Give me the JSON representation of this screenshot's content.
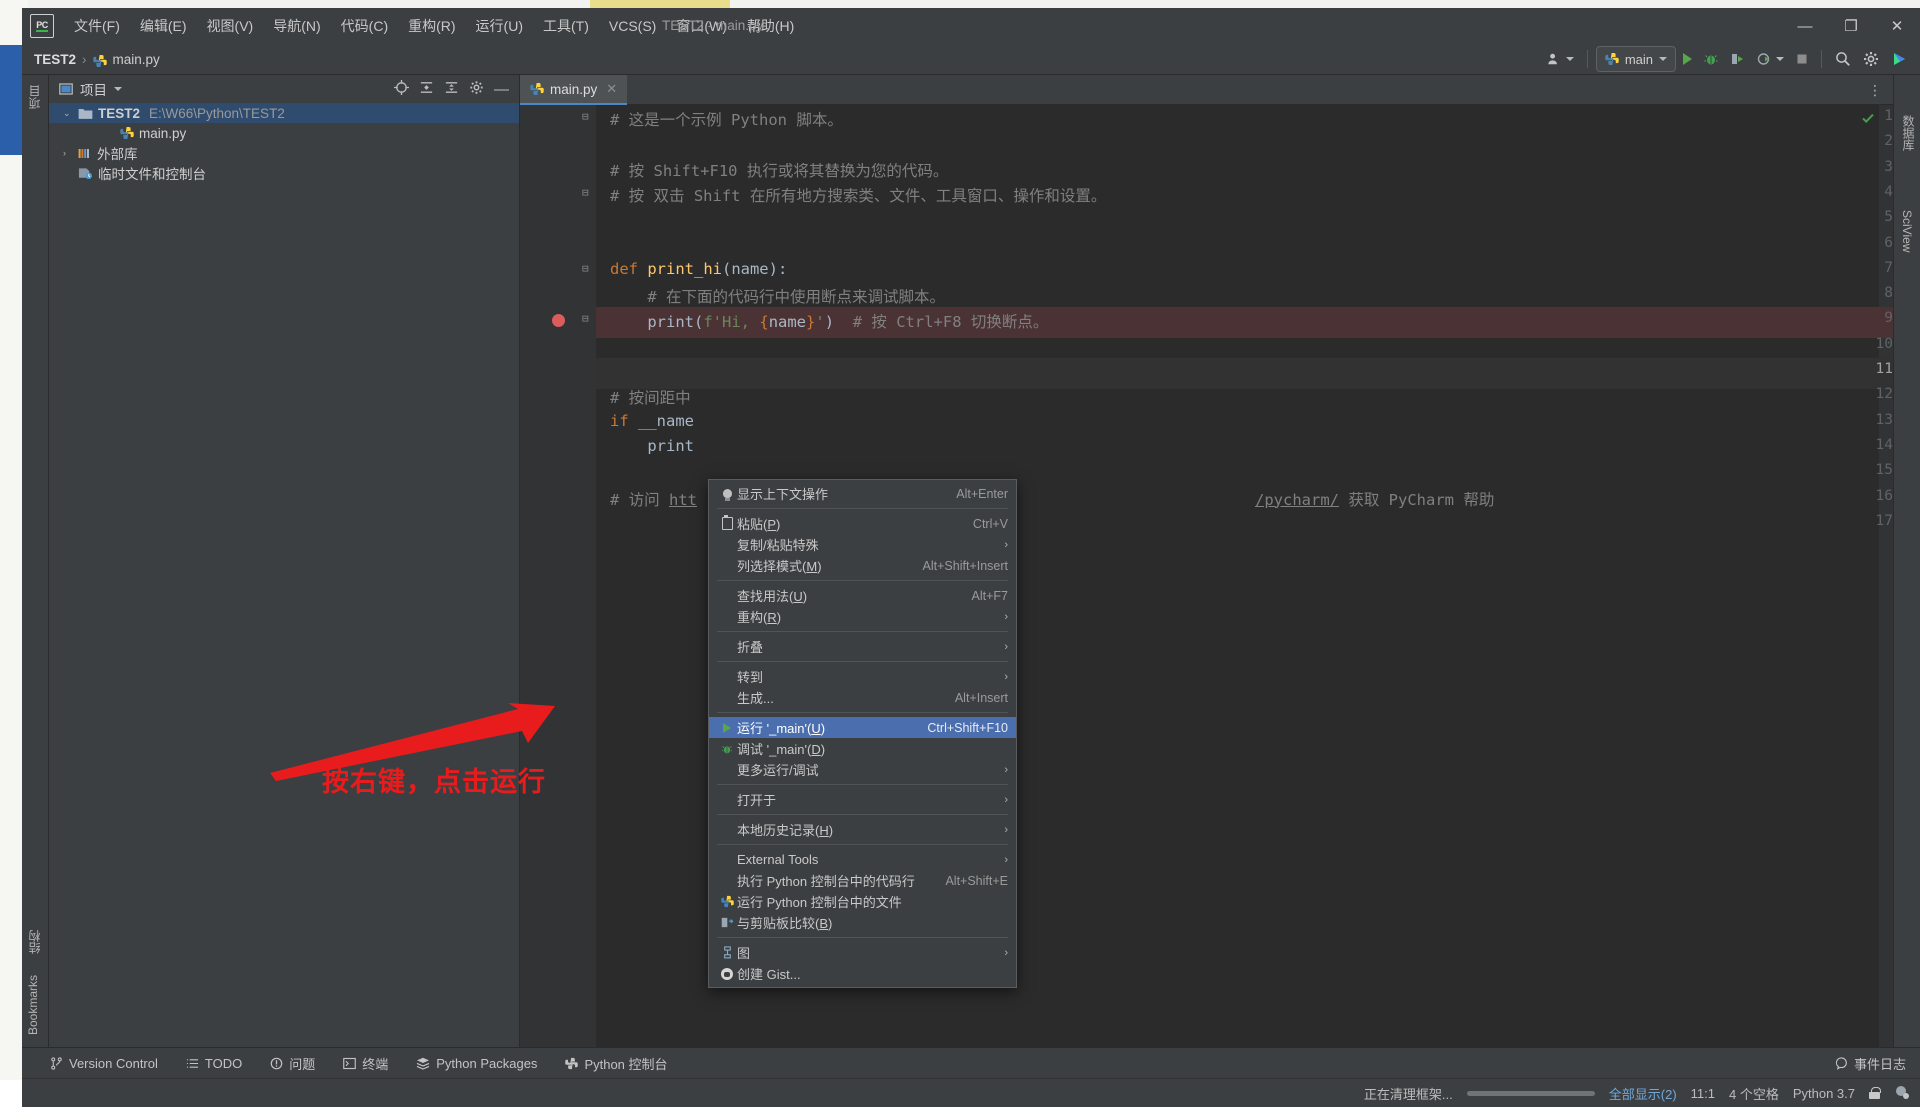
{
  "window": {
    "title": "TEST2 - main.py",
    "minimize": "—",
    "maximize": "❐",
    "close": "✕"
  },
  "menubar": {
    "items": [
      {
        "label": "文件(F)",
        "name": "menu-file"
      },
      {
        "label": "编辑(E)",
        "name": "menu-edit"
      },
      {
        "label": "视图(V)",
        "name": "menu-view"
      },
      {
        "label": "导航(N)",
        "name": "menu-navigate"
      },
      {
        "label": "代码(C)",
        "name": "menu-code"
      },
      {
        "label": "重构(R)",
        "name": "menu-refactor"
      },
      {
        "label": "运行(U)",
        "name": "menu-run"
      },
      {
        "label": "工具(T)",
        "name": "menu-tools"
      },
      {
        "label": "VCS(S)",
        "name": "menu-vcs"
      },
      {
        "label": "窗口(W)",
        "name": "menu-window"
      },
      {
        "label": "帮助(H)",
        "name": "menu-help"
      }
    ]
  },
  "breadcrumb": {
    "project": "TEST2",
    "separator": "›",
    "file": "main.py"
  },
  "toolbar": {
    "run_config": "main",
    "run_tooltip": "运行",
    "debug_tooltip": "调试",
    "coverage_tooltip": "运行覆盖率",
    "profile_tooltip": "分析",
    "stop_tooltip": "停止",
    "search_tooltip": "搜索",
    "settings_tooltip": "设置"
  },
  "left_strip": {
    "project_label": "项目",
    "structure_label": "结构",
    "bookmarks_label": "Bookmarks"
  },
  "right_strip": {
    "database_label": "数据库",
    "sciview_label": "SciView"
  },
  "project_panel": {
    "title": "项目",
    "tree": [
      {
        "label": "TEST2",
        "path": "E:\\W66\\Python\\TEST2",
        "icon": "folder-icon",
        "selected": true,
        "arrow": "⌄",
        "depth": 0
      },
      {
        "label": "main.py",
        "path": "",
        "icon": "python-file-icon",
        "selected": false,
        "arrow": "",
        "depth": 1
      },
      {
        "label": "外部库",
        "path": "",
        "icon": "library-icon",
        "selected": false,
        "arrow": "›",
        "depth": 0
      },
      {
        "label": "临时文件和控制台",
        "path": "",
        "icon": "scratches-icon",
        "selected": false,
        "arrow": "",
        "depth": 0
      }
    ]
  },
  "editor": {
    "tab": {
      "label": "main.py",
      "close": "✕"
    },
    "cursor_line_number": 11,
    "breakpoint_line": 9,
    "lines": [
      {
        "n": 1,
        "fold": "⊟",
        "tokens": [
          {
            "t": "# 这是一个示例 Python 脚本。",
            "c": "cm"
          }
        ],
        "indent": 0
      },
      {
        "n": 2,
        "fold": "",
        "tokens": [],
        "indent": 0
      },
      {
        "n": 3,
        "fold": "",
        "tokens": [
          {
            "t": "# 按 Shift+F10 执行或将其替换为您的代码。",
            "c": "cm"
          }
        ],
        "indent": 0
      },
      {
        "n": 4,
        "fold": "⊟",
        "tokens": [
          {
            "t": "# 按 双击 Shift 在所有地方搜索类、文件、工具窗口、操作和设置。",
            "c": "cm"
          }
        ],
        "indent": 0
      },
      {
        "n": 5,
        "fold": "",
        "tokens": [],
        "indent": 0
      },
      {
        "n": 6,
        "fold": "",
        "tokens": [],
        "indent": 0
      },
      {
        "n": 7,
        "fold": "⊟",
        "tokens": [
          {
            "t": "def ",
            "c": "kw"
          },
          {
            "t": "print_hi",
            "c": "fn"
          },
          {
            "t": "(name):",
            "c": "pm"
          }
        ],
        "indent": 0
      },
      {
        "n": 8,
        "fold": "",
        "tokens": [
          {
            "t": "    # 在下面的代码行中使用断点来调试脚本。",
            "c": "cm"
          }
        ],
        "indent": 1
      },
      {
        "n": 9,
        "fold": "⊟",
        "tokens": [
          {
            "t": "    print",
            "c": "pm"
          },
          {
            "t": "(",
            "c": "br"
          },
          {
            "t": "f'Hi, ",
            "c": "st"
          },
          {
            "t": "{",
            "c": "kw"
          },
          {
            "t": "name",
            "c": "pm"
          },
          {
            "t": "}",
            "c": "kw"
          },
          {
            "t": "'",
            "c": "st"
          },
          {
            "t": ")",
            "c": "br"
          },
          {
            "t": "  # 按 Ctrl+F8 切换断点。",
            "c": "cm"
          }
        ],
        "indent": 1
      },
      {
        "n": 10,
        "fold": "",
        "tokens": [],
        "indent": 0
      },
      {
        "n": 11,
        "fold": "",
        "tokens": [],
        "indent": 0
      },
      {
        "n": 12,
        "fold": "",
        "tokens": [
          {
            "t": "# 按间距中",
            "c": "cm"
          }
        ],
        "indent": 0
      },
      {
        "n": 13,
        "fold": "",
        "tokens": [
          {
            "t": "if ",
            "c": "kw"
          },
          {
            "t": "__name",
            "c": "pm"
          }
        ],
        "indent": 0
      },
      {
        "n": 14,
        "fold": "",
        "tokens": [
          {
            "t": "    print",
            "c": "pm"
          }
        ],
        "indent": 1
      },
      {
        "n": 15,
        "fold": "",
        "tokens": [],
        "indent": 0
      },
      {
        "n": 16,
        "fold": "",
        "tokens": [
          {
            "t": "# 访问 ",
            "c": "cm"
          },
          {
            "t": "htt",
            "c": "link"
          }
        ],
        "indent": 0
      },
      {
        "n": 17,
        "fold": "",
        "tokens": [],
        "indent": 0
      }
    ],
    "line16_tail": "/pycharm/ 获取 PyCharm 帮助"
  },
  "context_menu": {
    "groups": [
      [
        {
          "label": "显示上下文操作",
          "accel": "Alt+Enter",
          "icon": "bulb-icon",
          "submenu": false,
          "selected": false,
          "name": "menu-show-context-actions"
        }
      ],
      [
        {
          "label": "粘贴(P)",
          "accel": "Ctrl+V",
          "icon": "clipboard-icon",
          "submenu": false,
          "selected": false,
          "name": "menu-paste"
        },
        {
          "label": "复制/粘贴特殊",
          "accel": "",
          "icon": "",
          "submenu": true,
          "selected": false,
          "name": "menu-copy-paste-special"
        },
        {
          "label": "列选择模式(M)",
          "accel": "Alt+Shift+Insert",
          "icon": "",
          "submenu": false,
          "selected": false,
          "name": "menu-column-selection-mode"
        }
      ],
      [
        {
          "label": "查找用法(U)",
          "accel": "Alt+F7",
          "icon": "",
          "submenu": false,
          "selected": false,
          "name": "menu-find-usages"
        },
        {
          "label": "重构(R)",
          "accel": "",
          "icon": "",
          "submenu": true,
          "selected": false,
          "name": "menu-refactor"
        }
      ],
      [
        {
          "label": "折叠",
          "accel": "",
          "icon": "",
          "submenu": true,
          "selected": false,
          "name": "menu-folding"
        }
      ],
      [
        {
          "label": "转到",
          "accel": "",
          "icon": "",
          "submenu": true,
          "selected": false,
          "name": "menu-goto"
        },
        {
          "label": "生成...",
          "accel": "Alt+Insert",
          "icon": "",
          "submenu": false,
          "selected": false,
          "name": "menu-generate"
        }
      ],
      [
        {
          "label": "运行 '_main'(U)",
          "accel": "Ctrl+Shift+F10",
          "icon": "run-icon",
          "submenu": false,
          "selected": true,
          "name": "menu-run-main"
        },
        {
          "label": "调试 '_main'(D)",
          "accel": "",
          "icon": "debug-icon",
          "submenu": false,
          "selected": false,
          "name": "menu-debug-main"
        },
        {
          "label": "更多运行/调试",
          "accel": "",
          "icon": "",
          "submenu": true,
          "selected": false,
          "name": "menu-more-run-debug"
        }
      ],
      [
        {
          "label": "打开于",
          "accel": "",
          "icon": "",
          "submenu": true,
          "selected": false,
          "name": "menu-open-in"
        }
      ],
      [
        {
          "label": "本地历史记录(H)",
          "accel": "",
          "icon": "",
          "submenu": true,
          "selected": false,
          "name": "menu-local-history"
        }
      ],
      [
        {
          "label": "External Tools",
          "accel": "",
          "icon": "",
          "submenu": true,
          "selected": false,
          "name": "menu-external-tools"
        },
        {
          "label": "执行 Python 控制台中的代码行",
          "accel": "Alt+Shift+E",
          "icon": "",
          "submenu": false,
          "selected": false,
          "name": "menu-execute-line-in-console"
        },
        {
          "label": "运行 Python 控制台中的文件",
          "accel": "",
          "icon": "python-icon",
          "submenu": false,
          "selected": false,
          "name": "menu-run-file-in-console"
        },
        {
          "label": "与剪贴板比较(B)",
          "accel": "",
          "icon": "compare-icon",
          "submenu": false,
          "selected": false,
          "name": "menu-compare-with-clipboard"
        }
      ],
      [
        {
          "label": "图",
          "accel": "",
          "icon": "diagram-icon",
          "submenu": true,
          "selected": false,
          "name": "menu-diagrams"
        },
        {
          "label": "创建 Gist...",
          "accel": "",
          "icon": "github-icon",
          "submenu": false,
          "selected": false,
          "name": "menu-create-gist"
        }
      ]
    ]
  },
  "annotation": {
    "text": "按右键，点击运行",
    "color": "#e81c1c"
  },
  "bottom_bar": {
    "items": [
      {
        "label": "Version Control",
        "icon": "branch-icon",
        "name": "tool-version-control"
      },
      {
        "label": "TODO",
        "icon": "list-icon",
        "name": "tool-todo"
      },
      {
        "label": "问题",
        "icon": "problems-icon",
        "name": "tool-problems"
      },
      {
        "label": "终端",
        "icon": "terminal-icon",
        "name": "tool-terminal"
      },
      {
        "label": "Python Packages",
        "icon": "packages-icon",
        "name": "tool-python-packages"
      },
      {
        "label": "Python 控制台",
        "icon": "python-console-icon",
        "name": "tool-python-console"
      }
    ],
    "event_log": "事件日志"
  },
  "status_bar": {
    "message": "正在清理框架...",
    "show_all": "全部显示(2)",
    "caret": "11:1",
    "indent": "4 个空格",
    "interpreter": "Python 3.7"
  }
}
